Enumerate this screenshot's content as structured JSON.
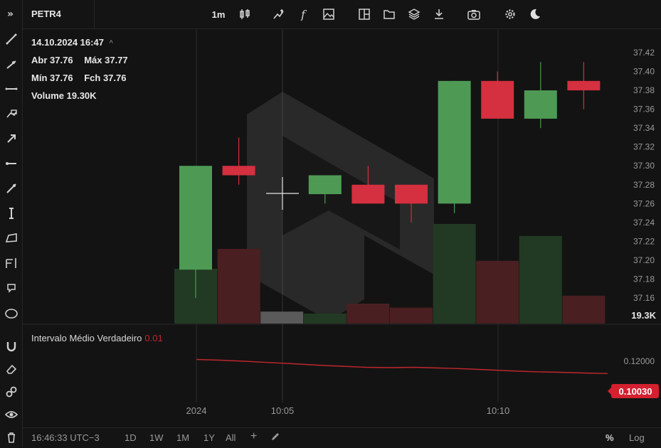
{
  "symbol": "PETR4",
  "toolbar": {
    "interval": "1m",
    "icons": [
      "candles-icon",
      "indicator-icon",
      "function-icon",
      "image-icon",
      "layout-icon",
      "folder-icon",
      "layers-icon",
      "download-icon",
      "camera-icon",
      "gear-icon",
      "moon-icon"
    ]
  },
  "sidebar_icons": [
    "expand-icon",
    "trend-line-icon",
    "ray-icon",
    "horizontal-line-icon",
    "brush-icon",
    "arrow-icon",
    "horizontal-ray-icon",
    "extended-line-icon",
    "vertical-range-icon",
    "parallelogram-icon",
    "fib-icon",
    "callout-icon",
    "ellipse-icon",
    "magnet-icon",
    "eraser-icon",
    "link-icon",
    "eye-icon",
    "trash-icon"
  ],
  "legend": {
    "datetime": "14.10.2024 16:47",
    "caret": "^",
    "open_label": "Abr",
    "open": "37.76",
    "high_label": "Máx",
    "high": "37.77",
    "low_label": "Mín",
    "low": "37.76",
    "close_label": "Fch",
    "close": "37.76",
    "volume_label": "Volume",
    "volume": "19.30K"
  },
  "indicator": {
    "name": "Intervalo Médio Verdadeiro",
    "value": "0.01",
    "axis_tick": "0.12000",
    "last_value": "0.10030"
  },
  "bottom_bar": {
    "clock": "16:46:33 UTC−3",
    "ranges": [
      "1D",
      "1W",
      "1M",
      "1Y",
      "All"
    ],
    "plus": "+",
    "percent": "%",
    "log": "Log"
  },
  "colors": {
    "up": "#4e9a55",
    "down": "#d4303f",
    "atr": "#c0272d",
    "volume_up": "#223a23",
    "volume_down": "#4a1f22"
  },
  "chart_data": {
    "type": "candlestick",
    "y_ticks": [
      "37.42",
      "37.40",
      "37.38",
      "37.36",
      "37.34",
      "37.32",
      "37.30",
      "37.28",
      "37.26",
      "37.24",
      "37.22",
      "37.20",
      "37.18",
      "37.16"
    ],
    "volume_label": "19.3K",
    "x_ticks": [
      "2024",
      "10:05",
      "10:10"
    ],
    "candles": [
      {
        "open": 37.19,
        "high": 37.3,
        "low": 37.16,
        "close": 37.3,
        "vol": 0.55,
        "dir": "up"
      },
      {
        "open": 37.3,
        "high": 37.33,
        "low": 37.28,
        "close": 37.29,
        "vol": 0.75,
        "dir": "down"
      },
      {
        "open": null,
        "high": null,
        "low": null,
        "close": null,
        "vol": 0.12,
        "dir": "neutral"
      },
      {
        "open": 37.27,
        "high": 37.29,
        "low": 37.26,
        "close": 37.29,
        "vol": 0.1,
        "dir": "up"
      },
      {
        "open": 37.28,
        "high": 37.3,
        "low": 37.26,
        "close": 37.26,
        "vol": 0.2,
        "dir": "down"
      },
      {
        "open": 37.28,
        "high": 37.28,
        "low": 37.24,
        "close": 37.26,
        "vol": 0.16,
        "dir": "down"
      },
      {
        "open": 37.26,
        "high": 37.39,
        "low": 37.25,
        "close": 37.39,
        "vol": 1.0,
        "dir": "up"
      },
      {
        "open": 37.39,
        "high": 37.4,
        "low": 37.35,
        "close": 37.35,
        "vol": 0.63,
        "dir": "down"
      },
      {
        "open": 37.35,
        "high": 37.41,
        "low": 37.34,
        "close": 37.38,
        "vol": 0.88,
        "dir": "up"
      },
      {
        "open": 37.39,
        "high": 37.41,
        "low": 37.36,
        "close": 37.38,
        "vol": 0.28,
        "dir": "down"
      }
    ],
    "atr_series": [
      0.1142,
      0.1138,
      0.1132,
      0.1125,
      0.1118,
      0.111,
      0.1104,
      0.1098,
      0.1096,
      0.1098,
      0.1094,
      0.109,
      0.1084,
      0.1078,
      0.1073,
      0.107,
      0.1066,
      0.1063
    ],
    "atr_ylim": [
      0.09,
      0.13
    ]
  }
}
